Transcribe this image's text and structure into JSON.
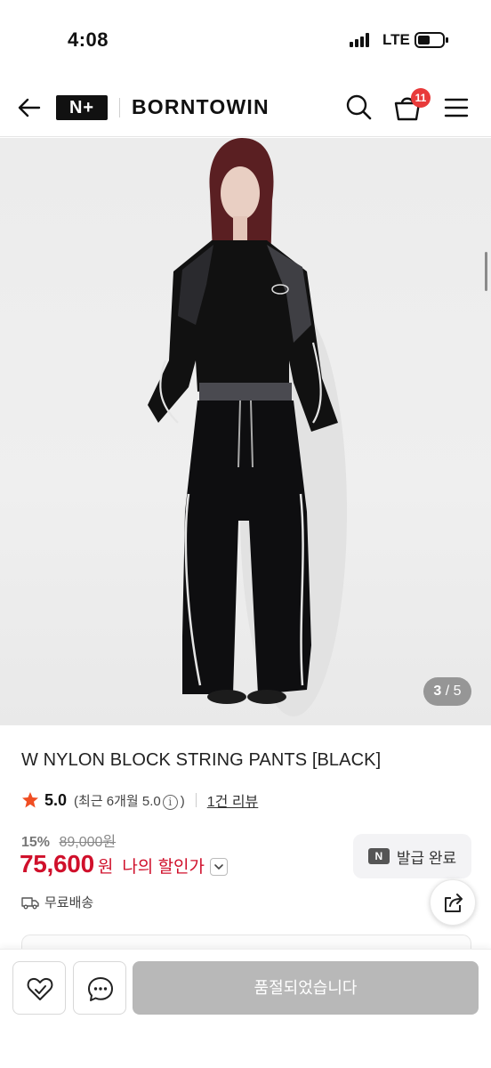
{
  "status_bar": {
    "time": "4:08",
    "network": "LTE"
  },
  "header": {
    "logo_badge": "N+",
    "brand": "BORNTOWIN",
    "cart_count": "11"
  },
  "gallery": {
    "current": "3",
    "separator": "/",
    "total": "5"
  },
  "product": {
    "title": "W NYLON BLOCK STRING PANTS [BLACK]",
    "rating_score": "5.0",
    "rating_detail_prefix": "(최근 6개월 5.0",
    "rating_detail_suffix": ")",
    "review_link": "1건 리뷰",
    "discount_rate": "15%",
    "original_price": "89,000원",
    "price": "75,600",
    "price_unit": "원",
    "my_discount_label": "나의 할인가",
    "coupon_badge": "N",
    "coupon_label": "발급 완료",
    "shipping": "무료배송"
  },
  "bottom_bar": {
    "soldout_label": "품절되었습니다"
  },
  "colors": {
    "price_red": "#d0102b",
    "badge_red": "#e83a3a",
    "star_orange": "#f04e23",
    "soldout_gray": "#b8b8b8"
  }
}
